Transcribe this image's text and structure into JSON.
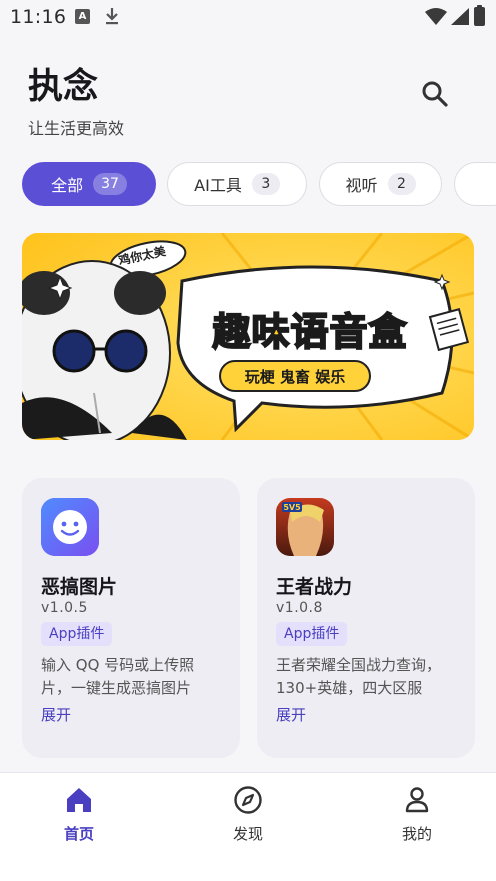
{
  "status_bar": {
    "time": "11:16"
  },
  "header": {
    "title": "执念",
    "subtitle": "让生活更高效"
  },
  "tabs": [
    {
      "label": "全部",
      "count": "37"
    },
    {
      "label": "AI工具",
      "count": "3"
    },
    {
      "label": "视听",
      "count": "2"
    }
  ],
  "banner": {
    "title": "趣味语音盒",
    "tags": "玩梗 鬼畜 娱乐",
    "bubble": "鸡你太美"
  },
  "cards": [
    {
      "name": "恶搞图片",
      "version": "v1.0.5",
      "tag": "App插件",
      "desc": "输入 QQ 号码或上传照片，一键生成恶搞图片",
      "expand": "展开"
    },
    {
      "name": "王者战力",
      "version": "v1.0.8",
      "tag": "App插件",
      "desc": "王者荣耀全国战力查询，130+英雄，四大区服",
      "expand": "展开"
    }
  ],
  "bottom_nav": [
    {
      "label": "首页",
      "icon": "home-icon"
    },
    {
      "label": "发现",
      "icon": "compass-icon"
    },
    {
      "label": "我的",
      "icon": "person-icon"
    }
  ],
  "colors": {
    "accent": "#5b4fd6",
    "banner_bg": "#ffd23a"
  }
}
